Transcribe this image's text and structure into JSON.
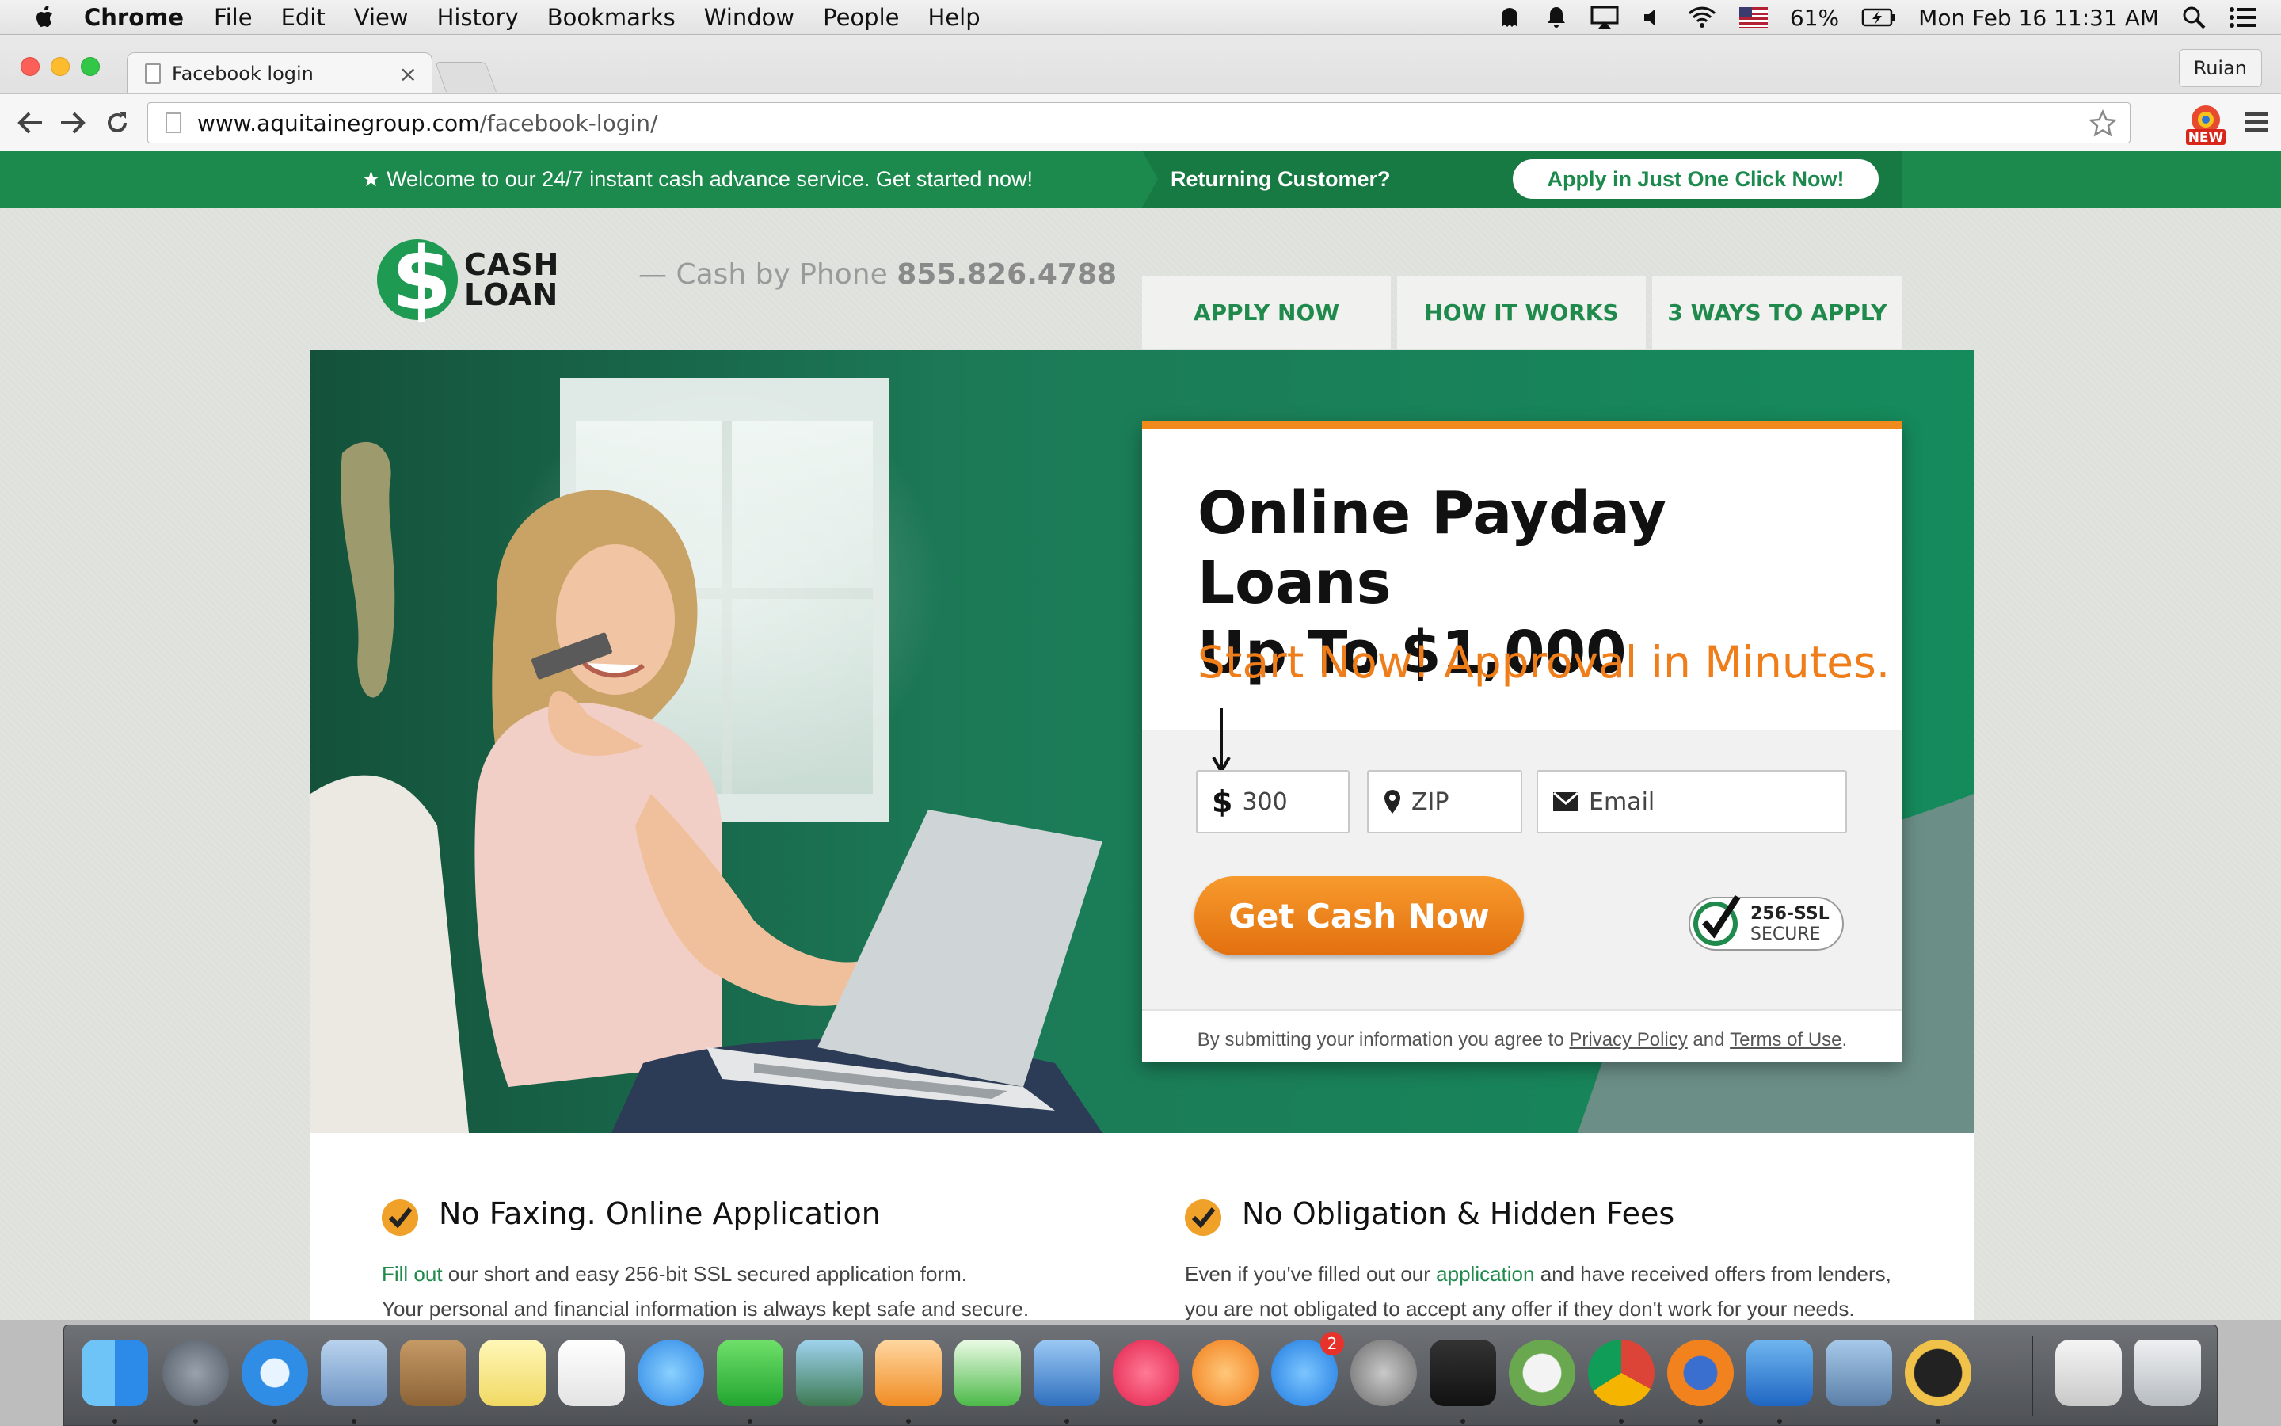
{
  "menubar": {
    "app": "Chrome",
    "items": [
      "File",
      "Edit",
      "View",
      "History",
      "Bookmarks",
      "Window",
      "People",
      "Help"
    ],
    "battery": "61%",
    "clock": "Mon Feb 16  11:31 AM"
  },
  "browser": {
    "tab_title": "Facebook login",
    "tab_close": "×",
    "profile": "Ruian",
    "url_host": "www.aquitainegroup.com",
    "url_path": "/facebook-login/"
  },
  "site": {
    "welcome": "★ Welcome to our 24/7 instant cash advance service. Get started now!",
    "returning": "Returning Customer?",
    "apply_click": "Apply in Just One Click Now!",
    "logo_line1": "CASH",
    "logo_line2": "LOAN",
    "logo_symbol": "$",
    "phone_prefix": "— Cash by Phone",
    "phone_number": "855.826.4788",
    "nav": [
      "APPLY NOW",
      "HOW IT WORKS",
      "3 WAYS TO APPLY"
    ],
    "card": {
      "title_line1": "Online Payday Loans",
      "title_line2": "Up To $1,000",
      "tagline": "Start Now! Approval in Minutes.",
      "amount_symbol": "$",
      "amount_value": "300",
      "zip_placeholder": "ZIP",
      "email_placeholder": "Email",
      "cta": "Get Cash Now",
      "ssl_top": "256-SSL",
      "ssl_bottom": "SECURE",
      "consent_prefix": "By submitting your information you agree to",
      "privacy": "Privacy Policy",
      "consent_and": "and",
      "terms": "Terms of Use",
      "consent_end": "."
    },
    "features": [
      {
        "title": "No Faxing. Online Application",
        "link": "Fill out",
        "text": " our short and easy 256-bit SSL secured application form.",
        "text2": "Your personal and financial information is always kept safe and secure."
      },
      {
        "title": "No Obligation & Hidden Fees",
        "text_a": "Even if you've filled out our ",
        "link": "application",
        "text_b": " and have received offers from lenders,",
        "text2": "you are not obligated to accept any offer if they don't work for your needs."
      }
    ]
  },
  "dock": {
    "badge": "2",
    "icons": [
      "finder-icon",
      "launchpad-icon",
      "safari-icon",
      "mail-icon",
      "contacts-icon",
      "notes-icon",
      "calendar-icon",
      "messages-icon",
      "facetime-icon",
      "photos-icon",
      "pages-icon",
      "numbers-icon",
      "keynote-icon",
      "itunes-icon",
      "ibooks-icon",
      "app-store-icon",
      "system-preferences-icon",
      "terminal-icon",
      "cyberduck-icon",
      "chrome-icon",
      "firefox-icon",
      "word-icon",
      "preview-icon",
      "qq-icon",
      "documents-icon",
      "trash-icon"
    ]
  },
  "colors": {
    "brand_green": "#1c8a4d",
    "accent_orange": "#ee7d1a"
  }
}
